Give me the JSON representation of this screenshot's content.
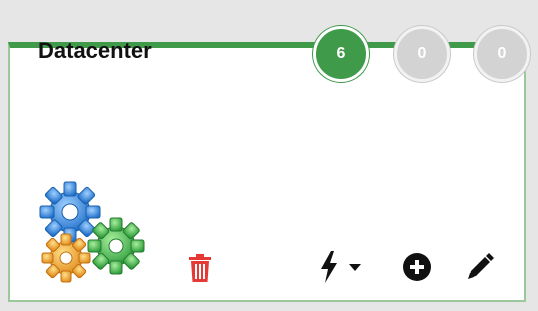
{
  "card": {
    "title": "Datacenter",
    "accent_color": "#3f9a4a",
    "border_color": "#9bc79b"
  },
  "badges": [
    {
      "value": "6",
      "state": "active",
      "color": "#3f9a4a"
    },
    {
      "value": "0",
      "state": "inactive",
      "color": "#d3d3d3"
    },
    {
      "value": "0",
      "state": "inactive",
      "color": "#d3d3d3"
    }
  ],
  "actions": {
    "delete_icon": "trash-icon",
    "delete_color": "#e53935",
    "trigger_icon": "lightning-icon",
    "trigger_dropdown_icon": "caret-down-icon",
    "add_icon": "plus-circle-icon",
    "edit_icon": "pencil-icon"
  },
  "logo": {
    "icon": "gears-icon",
    "colors": [
      "#2e7fd6",
      "#f2a93b",
      "#3fb34f"
    ]
  }
}
